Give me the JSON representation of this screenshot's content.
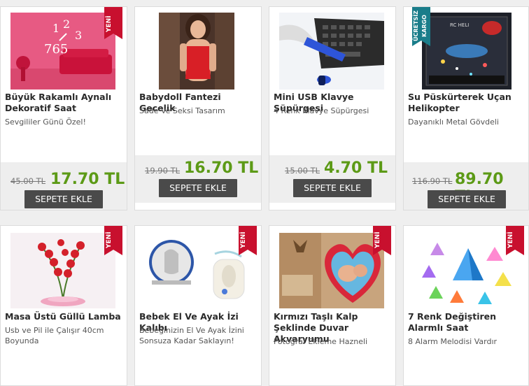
{
  "products": [
    {
      "title": "Büyük Rakamlı Aynalı Dekoratif Saat",
      "subtitle": "Sevgililer Günü Özel!",
      "old_price": "45.00 TL",
      "new_price": "17.70 TL",
      "button": "SEPETE EKLE",
      "badge": "YENİ"
    },
    {
      "title": "Babydoll Fantezi Gecelik",
      "subtitle": "Sade Ve Seksi Tasarım",
      "old_price": "19.90 TL",
      "new_price": "16.70 TL",
      "button": "SEPETE EKLE",
      "badge": ""
    },
    {
      "title": "Mini USB Klavye Süpürgesi",
      "subtitle": "4 Renk Klavye Süpürgesi",
      "old_price": "15.00 TL",
      "new_price": "4.70 TL",
      "button": "SEPETE EKLE",
      "badge": ""
    },
    {
      "title": "Su Püskürterek Uçan Helikopter",
      "subtitle": "Dayanıklı Metal Gövdeli",
      "old_price": "116.90 TL",
      "new_price": "89.70 TL",
      "button": "SEPETE EKLE",
      "badge": "ÜCRETSİZ KARGO"
    },
    {
      "title": "Masa Üstü Güllü Lamba",
      "subtitle": "Usb ve Pil ile Çalışır 40cm Boyunda",
      "badge": "YENİ"
    },
    {
      "title": "Bebek El Ve Ayak İzi Kalıbı",
      "subtitle": "Bebeğinizin El Ve Ayak İzini Sonsuza Kadar Saklayın!",
      "badge": "YENİ"
    },
    {
      "title": "Kırmızı Taşlı Kalp Şeklinde Duvar Akvaryumu",
      "subtitle": "Fotoğraf Ekleme Hazneli",
      "badge": "YENİ"
    },
    {
      "title": "7 Renk Değiştiren Alarmlı Saat",
      "subtitle": "8 Alarm Melodisi Vardır",
      "badge": "YENİ"
    }
  ],
  "product_images": [
    "wall-clock",
    "woman-in-red-lingerie",
    "keyboard-vacuum",
    "rc-helicopter",
    "rose-lamp",
    "baby-print-kit",
    "heart-aquarium",
    "pyramid-clocks"
  ],
  "colors": {
    "price_green": "#5c9a16",
    "button_bg": "#4a4a4a",
    "ribbon_red": "#c8102e",
    "ribbon_teal": "#1a7d8a"
  }
}
